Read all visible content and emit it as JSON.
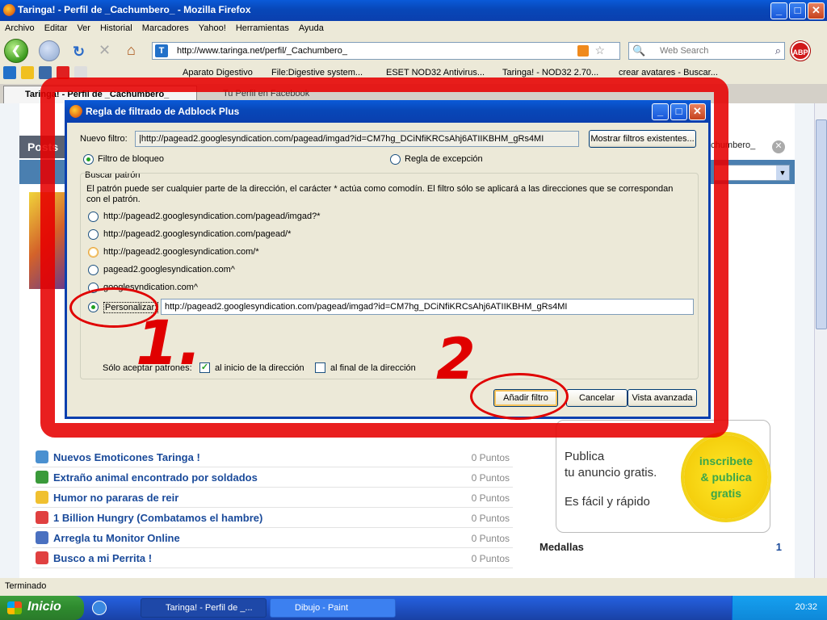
{
  "browser": {
    "title": "Taringa! - Perfil de _Cachumbero_ - Mozilla Firefox",
    "menu": [
      "Archivo",
      "Editar",
      "Ver",
      "Historial",
      "Marcadores",
      "Yahoo!",
      "Herramientas",
      "Ayuda"
    ],
    "url": "http://www.taringa.net/perfil/_Cachumbero_",
    "search_placeholder": "Web Search",
    "abp_label": "ABP",
    "bookmarks": [
      "Aparato Digestivo",
      "File:Digestive system...",
      "ESET NOD32 Antivirus...",
      "Taringa! - NOD32 2.70...",
      "crear avatares - Buscar..."
    ],
    "tabs": [
      "Taringa! - Perfil de _Cachumbero_",
      "Tu Perfil en Facebook"
    ],
    "status": "Terminado"
  },
  "page": {
    "posts_tab": "Posts",
    "user_tag": "_Cachumbero_",
    "posts": [
      {
        "title": "Nuevos Emoticones Taringa !",
        "points": "0 Puntos",
        "icon_color": "#4a90d0"
      },
      {
        "title": "Extraño animal encontrado por soldados",
        "points": "0 Puntos",
        "icon_color": "#3a9a3a"
      },
      {
        "title": "Humor no pararas de reir",
        "points": "0 Puntos",
        "icon_color": "#f0c030"
      },
      {
        "title": "1 Billion Hungry (Combatamos el hambre)",
        "points": "0 Puntos",
        "icon_color": "#e04040"
      },
      {
        "title": "Arregla tu Monitor Online",
        "points": "0 Puntos",
        "icon_color": "#4a70c0"
      },
      {
        "title": "Busco a mi Perrita !",
        "points": "0 Puntos",
        "icon_color": "#e04040"
      }
    ],
    "ad": {
      "line1": "Publica",
      "line2": "tu anuncio gratis.",
      "line3": "Es fácil y rápido",
      "burst1": "inscribete",
      "burst2": "& publica",
      "burst3": "gratis"
    },
    "medallas_label": "Medallas",
    "medallas_count": "1"
  },
  "dialog": {
    "title": "Regla de filtrado de Adblock Plus",
    "new_filter_label": "Nuevo filtro:",
    "new_filter_value": "|http://pagead2.googlesyndication.com/pagead/imgad?id=CM7hg_DCiNfiKRCsAhj6ATIIKBHM_gRs4MI",
    "show_filters_button": "Mostrar filtros existentes...",
    "block_filter_label": "Filtro de bloqueo",
    "exception_rule_label": "Regla de excepción",
    "search_pattern_label": "Buscar patrón",
    "help_text": "El patrón puede ser cualquier parte de la dirección, el carácter * actúa como comodín. El filtro sólo se aplicará a las direcciones que se correspondan con el patrón.",
    "patterns": [
      "http://pagead2.googlesyndication.com/pagead/imgad?*",
      "http://pagead2.googlesyndication.com/pagead/*",
      "http://pagead2.googlesyndication.com/*",
      "pagead2.googlesyndication.com^",
      "googlesyndication.com^"
    ],
    "custom_label": "Personalizar:",
    "custom_value": "http://pagead2.googlesyndication.com/pagead/imgad?id=CM7hg_DCiNfiKRCsAhj6ATIIKBHM_gRs4MI",
    "only_accept": "Sólo aceptar patrones:",
    "start_of_address": "al inicio de la dirección",
    "end_of_address": "al final de la dirección",
    "add_filter_button": "Añadir filtro",
    "cancel_button": "Cancelar",
    "advanced_view_button": "Vista avanzada"
  },
  "annotations": {
    "one": "1.",
    "two": "2"
  },
  "taskbar": {
    "start_label": "Inicio",
    "items": [
      "Taringa! - Perfil de _...",
      "Dibujo - Paint"
    ],
    "clock": "20:32"
  }
}
